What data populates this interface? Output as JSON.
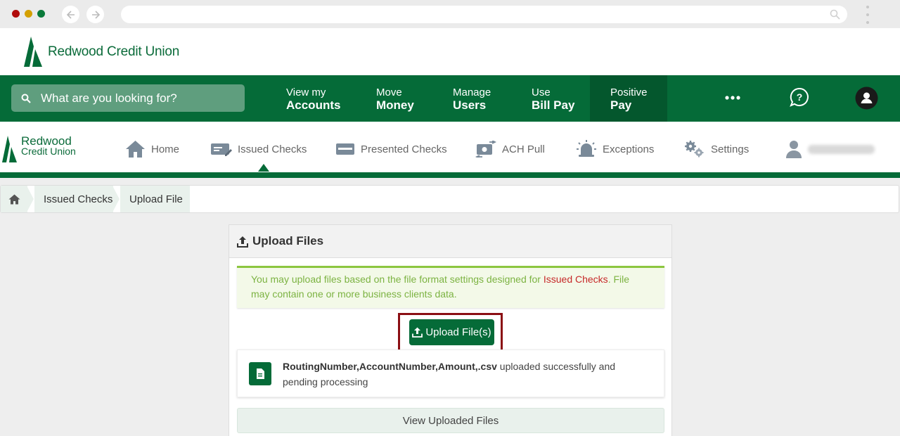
{
  "browser": {
    "dots": [
      "#b00b0b",
      "#d4a000",
      "#0a7a3a"
    ]
  },
  "brand": {
    "name": "Redwood Credit Union",
    "sub_line1": "Redwood",
    "sub_line2": "Credit Union",
    "color": "#056b38"
  },
  "topnav": {
    "search_placeholder": "What are you looking for?",
    "items": [
      {
        "line1": "View my",
        "line2": "Accounts"
      },
      {
        "line1": "Move",
        "line2": "Money"
      },
      {
        "line1": "Manage",
        "line2": "Users"
      },
      {
        "line1": "Use",
        "line2": "Bill Pay"
      },
      {
        "line1": "Positive",
        "line2": "Pay"
      }
    ],
    "more_icon": "more-dots-icon",
    "help_icon": "help-chat-icon",
    "profile_icon": "user-icon"
  },
  "subnav": {
    "items": [
      {
        "label": "Home",
        "icon": "home-icon"
      },
      {
        "label": "Issued Checks",
        "icon": "check-pen-icon"
      },
      {
        "label": "Presented Checks",
        "icon": "card-icon"
      },
      {
        "label": "ACH Pull",
        "icon": "transfer-icon"
      },
      {
        "label": "Exceptions",
        "icon": "alarm-icon"
      },
      {
        "label": "Settings",
        "icon": "gears-icon"
      }
    ],
    "user_icon": "user-icon"
  },
  "breadcrumb": {
    "items": [
      "Issued Checks",
      "Upload File"
    ]
  },
  "panel": {
    "title": "Upload Files",
    "alert_pre": "You may upload files based on the file format settings designed for ",
    "alert_link": "Issued Checks",
    "alert_post": ". File may contain one or more business clients data.",
    "upload_button": "Upload File(s)",
    "file_name": "RoutingNumber,AccountNumber,Amount,.csv",
    "file_status": " uploaded successfully and pending processing",
    "view_button": "View Uploaded Files"
  }
}
